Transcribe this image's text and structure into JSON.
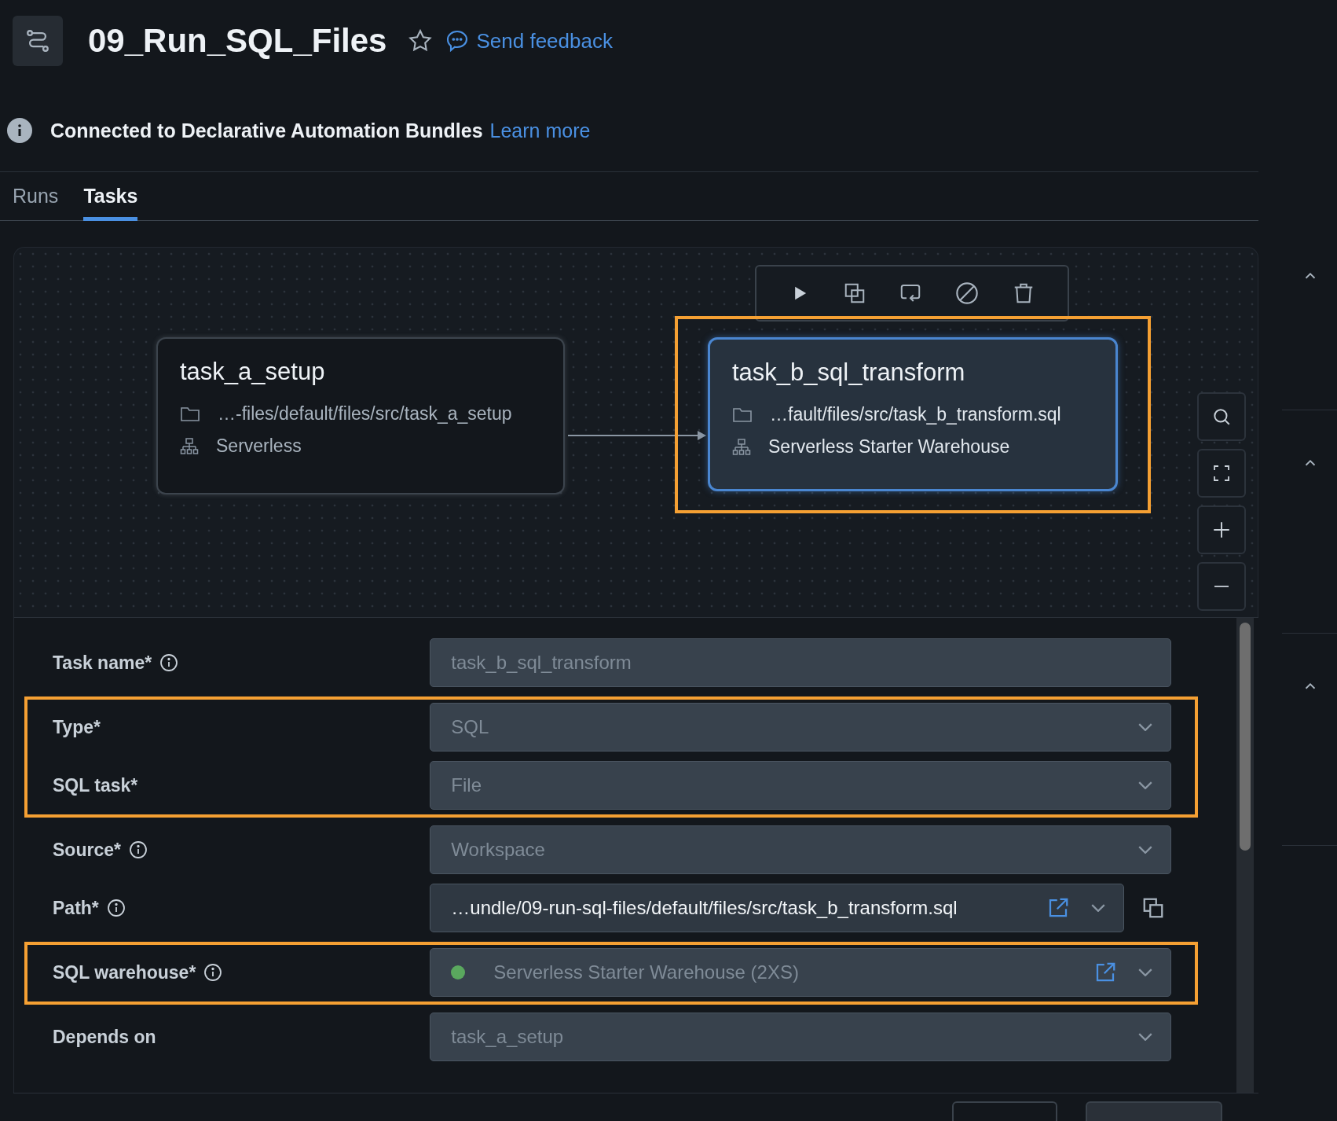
{
  "header": {
    "title": "09_Run_SQL_Files",
    "starred": false,
    "feedback": "Send feedback"
  },
  "banner": {
    "text": "Connected to Declarative Automation Bundles",
    "link": "Learn more"
  },
  "tabs": [
    {
      "label": "Runs",
      "selected": false
    },
    {
      "label": "Tasks",
      "selected": true
    }
  ],
  "graph": {
    "nodes": [
      {
        "name": "task_a_setup",
        "path": "…-files/default/files/src/task_a_setup",
        "compute": "Serverless",
        "selected": false,
        "highlighted": false
      },
      {
        "name": "task_b_sql_transform",
        "path": "…fault/files/src/task_b_transform.sql",
        "compute": "Serverless Starter Warehouse",
        "selected": true,
        "highlighted": true
      }
    ]
  },
  "form": {
    "sections": [
      {
        "highlighted": false,
        "rows": [
          {
            "label": "Task name*",
            "info": true,
            "kind": "input",
            "value": "task_b_sql_transform",
            "disabled": true
          }
        ]
      },
      {
        "highlighted": true,
        "rows": [
          {
            "label": "Type*",
            "info": false,
            "kind": "select",
            "value": "SQL",
            "disabled": true
          },
          {
            "label": "SQL task*",
            "info": false,
            "kind": "select",
            "value": "File",
            "disabled": true
          }
        ]
      },
      {
        "highlighted": false,
        "rows": [
          {
            "label": "Source*",
            "info": true,
            "kind": "select",
            "value": "Workspace",
            "disabled": true
          },
          {
            "label": "Path*",
            "info": true,
            "kind": "select",
            "value": "…undle/09-run-sql-files/default/files/src/task_b_transform.sql",
            "disabled": false,
            "external_link": true,
            "copy": true
          }
        ]
      },
      {
        "highlighted": true,
        "rows": [
          {
            "label": "SQL warehouse*",
            "info": true,
            "kind": "select",
            "value": "Serverless Starter Warehouse (2XS)",
            "disabled": true,
            "external_link": true,
            "online": true
          }
        ]
      },
      {
        "highlighted": false,
        "rows": [
          {
            "label": "Depends on",
            "info": false,
            "kind": "select",
            "value": "task_a_setup",
            "disabled": true
          }
        ]
      }
    ]
  }
}
